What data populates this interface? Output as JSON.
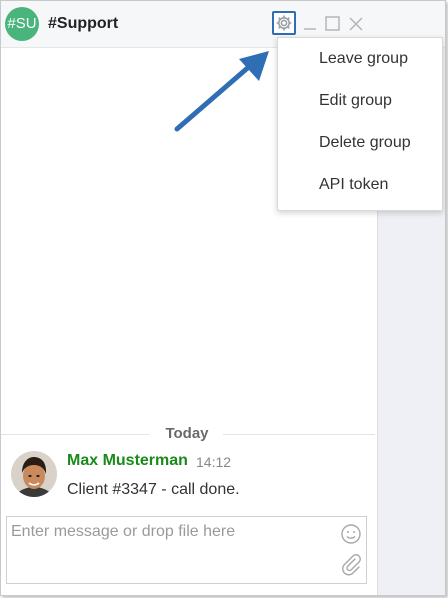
{
  "header": {
    "avatar_text": "#SU",
    "title": "#Support",
    "icons": [
      "gear-icon",
      "minimize-icon",
      "maximize-icon",
      "close-icon"
    ]
  },
  "menu": {
    "items": [
      {
        "label": "Leave group"
      },
      {
        "label": "Edit group"
      },
      {
        "label": "Delete group"
      },
      {
        "label": "API token"
      }
    ]
  },
  "chat": {
    "day_separator": "Today",
    "messages": [
      {
        "author": "Max Musterman",
        "time": "14:12",
        "text": "Client #3347 - call done."
      }
    ]
  },
  "composer": {
    "placeholder": "Enter message or drop file here",
    "value": "",
    "icons": [
      "emoji-icon",
      "attachment-icon"
    ]
  },
  "colors": {
    "group_avatar": "#49b47c",
    "author": "#1a8a1a",
    "highlight": "#2f6db5"
  }
}
